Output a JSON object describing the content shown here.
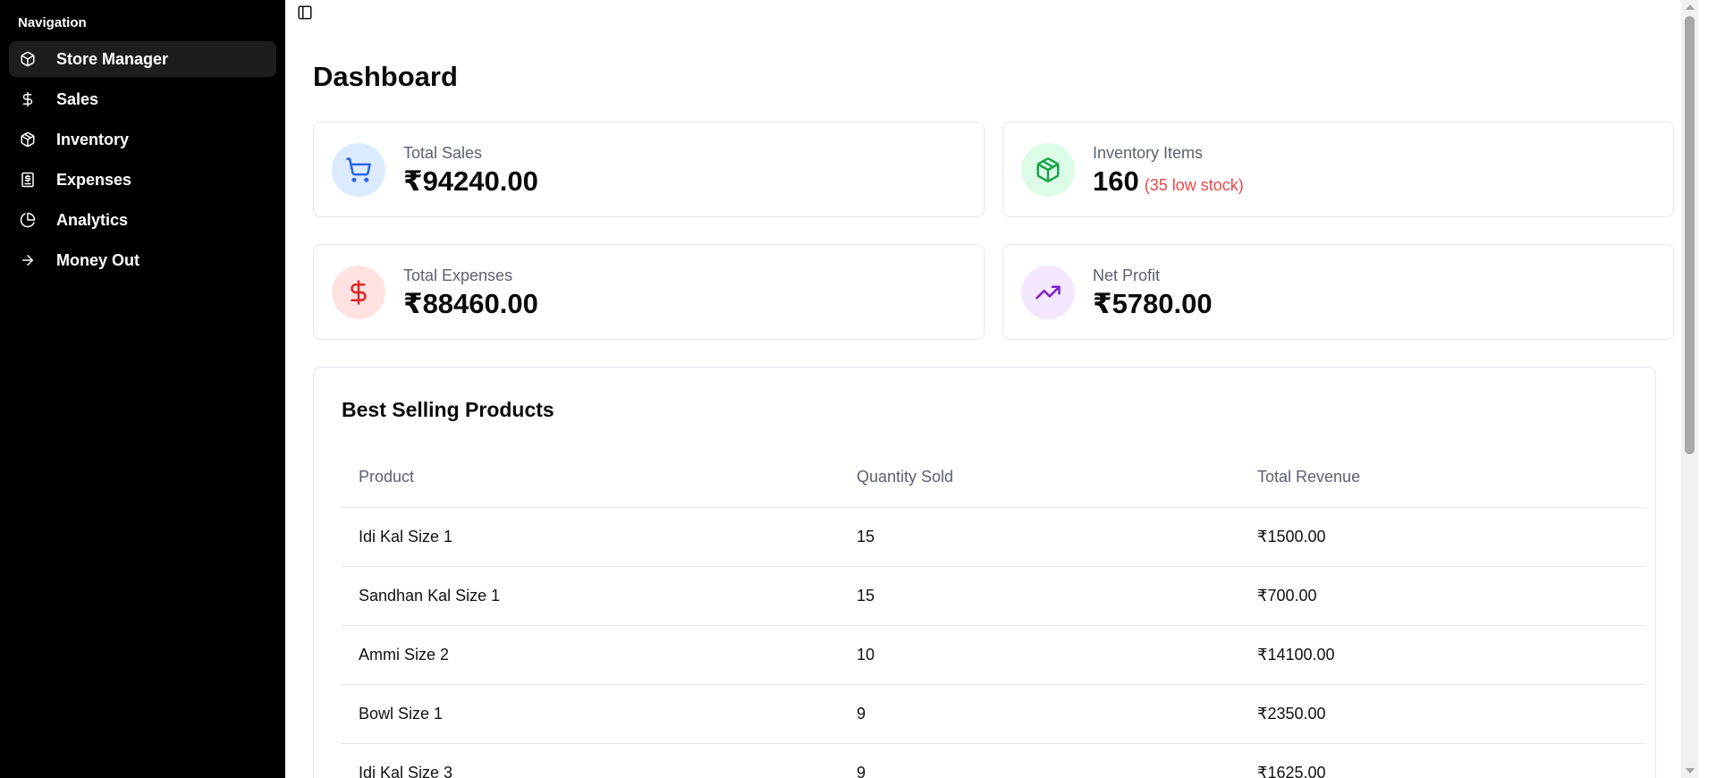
{
  "sidebar": {
    "heading": "Navigation",
    "items": [
      {
        "label": "Store Manager",
        "icon": "box-icon",
        "active": true
      },
      {
        "label": "Sales",
        "icon": "dollar-icon",
        "active": false
      },
      {
        "label": "Inventory",
        "icon": "boxes-icon",
        "active": false
      },
      {
        "label": "Expenses",
        "icon": "receipt-icon",
        "active": false
      },
      {
        "label": "Analytics",
        "icon": "pie-chart-icon",
        "active": false
      },
      {
        "label": "Money Out",
        "icon": "arrow-right-icon",
        "active": false
      }
    ]
  },
  "header": {
    "toggle_icon": "sidebar-toggle-icon"
  },
  "main": {
    "title": "Dashboard",
    "cards": [
      {
        "label": "Total Sales",
        "value": "₹94240.00",
        "icon": "shopping-cart-icon",
        "accent": "#2563eb",
        "bg": "#dbeafe"
      },
      {
        "label": "Inventory Items",
        "value": "160",
        "note": "(35 low stock)",
        "icon": "package-icon",
        "accent": "#16a34a",
        "bg": "#dcfce7"
      },
      {
        "label": "Total Expenses",
        "value": "₹88460.00",
        "icon": "dollar-sign-icon",
        "accent": "#dc2626",
        "bg": "#fee2e2"
      },
      {
        "label": "Net Profit",
        "value": "₹5780.00",
        "icon": "trending-up-icon",
        "accent": "#7e22ce",
        "bg": "#f3e8ff"
      }
    ],
    "best_selling": {
      "title": "Best Selling Products",
      "columns": [
        "Product",
        "Quantity Sold",
        "Total Revenue"
      ],
      "rows": [
        [
          "Idi Kal Size 1",
          "15",
          "₹1500.00"
        ],
        [
          "Sandhan Kal Size 1",
          "15",
          "₹700.00"
        ],
        [
          "Ammi Size 2",
          "10",
          "₹14100.00"
        ],
        [
          "Bowl Size 1",
          "9",
          "₹2350.00"
        ],
        [
          "Idi Kal Size 3",
          "9",
          "₹1625.00"
        ]
      ]
    }
  },
  "colors": {
    "sidebar_bg": "#000000",
    "active_item_bg": "#1d1d1d",
    "low_stock": "#ef4444"
  }
}
